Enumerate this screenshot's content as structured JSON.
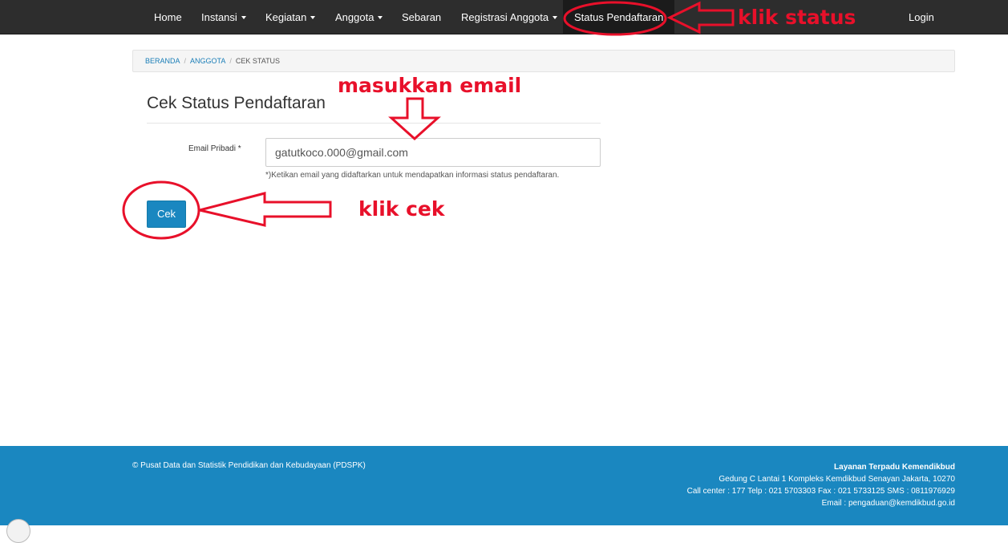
{
  "nav": {
    "items": [
      {
        "label": "Home",
        "dropdown": false
      },
      {
        "label": "Instansi",
        "dropdown": true
      },
      {
        "label": "Kegiatan",
        "dropdown": true
      },
      {
        "label": "Anggota",
        "dropdown": true
      },
      {
        "label": "Sebaran",
        "dropdown": false
      },
      {
        "label": "Registrasi Anggota",
        "dropdown": true
      },
      {
        "label": "Status Pendaftaran",
        "dropdown": false,
        "active": true
      }
    ],
    "login": "Login"
  },
  "breadcrumb": [
    "BERANDA",
    "ANGGOTA",
    "CEK STATUS"
  ],
  "form": {
    "title": "Cek Status Pendaftaran",
    "email_label": "Email Pribadi *",
    "email_value": "gatutkoco.000@gmail.com",
    "help": "*)Ketikan email yang didaftarkan untuk mendapatkan informasi status pendaftaran.",
    "submit": "Cek"
  },
  "annotations": {
    "status": "klik status",
    "email": "masukkan email",
    "cek": "klik cek"
  },
  "footer": {
    "copyright": "© Pusat Data dan Statistik Pendidikan dan Kebudayaan (PDSPK)",
    "service_title": "Layanan Terpadu Kemendikbud",
    "address": "Gedung C Lantai 1 Kompleks Kemdikbud Senayan Jakarta, 10270",
    "callcenter": "Call center : 177 Telp : 021 5703303 Fax : 021 5733125 SMS : 0811976929",
    "email": "Email : pengaduan@kemdikbud.go.id"
  },
  "colors": {
    "navbar": "#2d2d2d",
    "accent": "#1a87c0",
    "annotation": "#e8102a"
  }
}
